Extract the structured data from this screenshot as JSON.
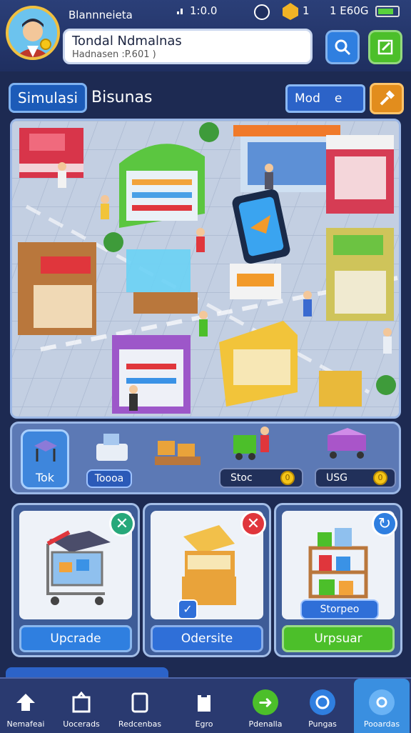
{
  "status": {
    "app_name": "Blannneieta",
    "time": "1:0.0",
    "gems": "1",
    "coins": "1 E60G"
  },
  "profile": {
    "name": "Tondal Ndmalnas",
    "subtitle": "Hadnasen :P.601 )"
  },
  "header": {
    "tab_label": "Simulasi",
    "title": "Bisunas",
    "mode_label": "Mod",
    "mode_suffix": "e"
  },
  "toolbar": {
    "tok_label": "Tok",
    "item2_label": "Toooa",
    "stock_label": "Stoc",
    "stock_value": "0",
    "usb_label": "USG",
    "usb_value": "0"
  },
  "cards": [
    {
      "button_label": "Upcrade",
      "button_color": "#2f7fe0",
      "badge_color": "#27a87a"
    },
    {
      "button_label": "Odersite",
      "button_color": "#2f6fd8",
      "badge_color": "#e0363c"
    },
    {
      "button_label": "Urpsuar",
      "button_color": "#4cbf2a",
      "badge_color": "#2f7fe0",
      "tag_label": "Storpeo"
    }
  ],
  "nav": [
    {
      "label": "Nemafeai",
      "icon": "home-icon"
    },
    {
      "label": "Uocerads",
      "icon": "box-icon"
    },
    {
      "label": "Redcenbas",
      "icon": "tablet-icon"
    },
    {
      "label": "Egro",
      "icon": "clipboard-icon"
    },
    {
      "label": "Pdenalla",
      "icon": "cart-icon"
    },
    {
      "label": "Pungas",
      "icon": "globe-icon"
    },
    {
      "label": "Pooardas",
      "icon": "settings-icon"
    }
  ]
}
